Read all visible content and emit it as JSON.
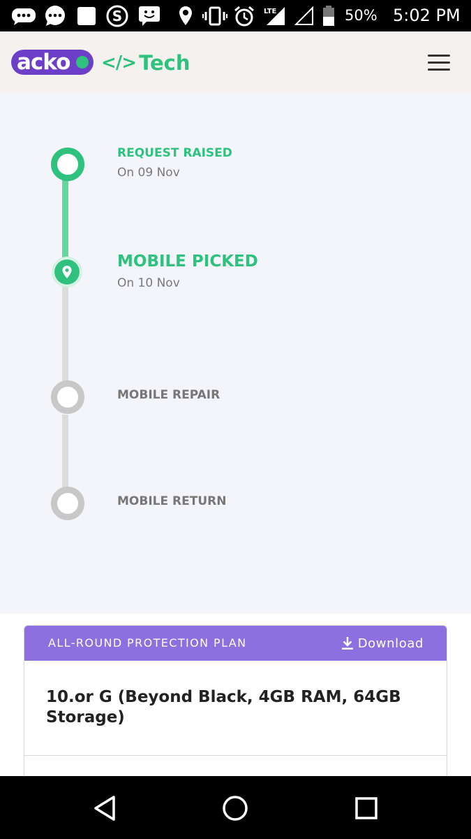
{
  "status_bar": {
    "battery": "50%",
    "time": "5:02 PM",
    "network": "LTE",
    "icons": [
      "chat-bubble-icon",
      "message-icon",
      "image-icon",
      "skype-icon",
      "emoji-message-icon",
      "location-icon",
      "vibrate-icon",
      "alarm-icon",
      "lte-signal-icon",
      "signal-icon",
      "battery-icon"
    ]
  },
  "header": {
    "brand": "acko",
    "code_glyph": "</>",
    "section": "Tech"
  },
  "timeline": {
    "steps": [
      {
        "title": "REQUEST RAISED",
        "date": "On 09 Nov",
        "state": "done"
      },
      {
        "title": "MOBILE PICKED",
        "date": "On 10 Nov",
        "state": "current"
      },
      {
        "title": "MOBILE REPAIR",
        "date": "",
        "state": "pending"
      },
      {
        "title": "MOBILE RETURN",
        "date": "",
        "state": "pending"
      }
    ]
  },
  "plan_card": {
    "plan_name": "ALL-ROUND PROTECTION PLAN",
    "download_label": "Download",
    "product": "10.or G (Beyond Black, 4GB RAM, 64GB Storage)"
  },
  "colors": {
    "green": "#2ec27e",
    "purple": "#8d6fe0",
    "grey": "#c8c8c8",
    "header_bg": "#f5f1ef",
    "timeline_bg": "#f4f5fa"
  }
}
